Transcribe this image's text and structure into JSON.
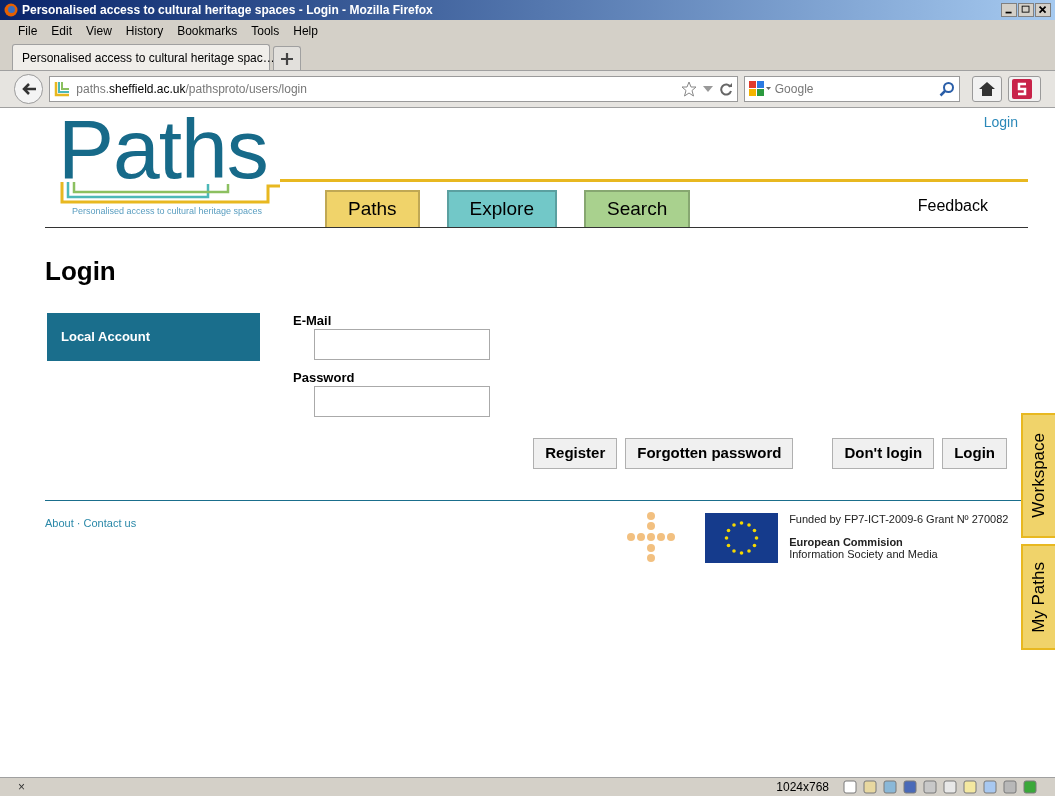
{
  "window": {
    "title": "Personalised access to cultural heritage spaces - Login - Mozilla Firefox"
  },
  "menu": [
    "File",
    "Edit",
    "View",
    "History",
    "Bookmarks",
    "Tools",
    "Help"
  ],
  "browser_tab": {
    "title": "Personalised access to cultural heritage spac…"
  },
  "address_bar": {
    "url": "paths.**sheffield.ac.uk**/pathsproto/users/login"
  },
  "search_bar": {
    "placeholder": "Google"
  },
  "page": {
    "header_link": "Login",
    "logo": {
      "title": "Paths",
      "tagline": "Personalised access to cultural heritage spaces"
    },
    "nav": [
      {
        "label": "Paths",
        "color": "#f0d36a"
      },
      {
        "label": "Explore",
        "color": "#72c8c8"
      },
      {
        "label": "Search",
        "color": "#a9d18e"
      }
    ],
    "feedback": "Feedback",
    "heading": "Login",
    "account_tabs": [
      {
        "label": "Local Account",
        "selected": true
      }
    ],
    "fields": [
      {
        "label": "E-Mail"
      },
      {
        "label": "Password"
      }
    ],
    "buttons": [
      "Register",
      "Forgotten password",
      "Don't login",
      "Login"
    ],
    "footer": {
      "links": [
        "About",
        "Contact us"
      ],
      "separator": "·",
      "funding": "Funded by FP7-ICT-2009-6 Grant Nº 270082",
      "org": "European Commision",
      "org_sub": "Information Society and Media"
    }
  },
  "side_tabs": [
    "Workspace",
    "My Paths"
  ],
  "status_bar": {
    "close": "×",
    "resolution": "1024x768"
  }
}
